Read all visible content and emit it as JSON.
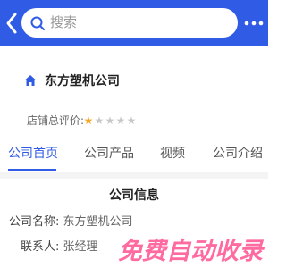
{
  "search": {
    "placeholder": "搜索"
  },
  "company": {
    "name": "东方塑机公司"
  },
  "rating": {
    "label": "店铺总评价:",
    "stars_filled": 1,
    "stars_total": 5
  },
  "tabs": [
    {
      "label": "公司首页",
      "active": true
    },
    {
      "label": "公司产品",
      "active": false
    },
    {
      "label": "视频",
      "active": false
    },
    {
      "label": "公司介绍",
      "active": false
    }
  ],
  "info": {
    "title": "公司信息",
    "rows": [
      {
        "key": "公司名称:",
        "value": "东方塑机公司"
      },
      {
        "key": "联系人:",
        "value": "张经理"
      }
    ]
  },
  "watermark": {
    "text": "免费自动收录"
  },
  "colors": {
    "accent": "#2f5be5",
    "star": "#f5a623",
    "watermark": "#ff6aa0"
  },
  "icons": [
    "back-arrow-icon",
    "search-icon",
    "more-dots-icon",
    "home-icon",
    "star-icon"
  ]
}
